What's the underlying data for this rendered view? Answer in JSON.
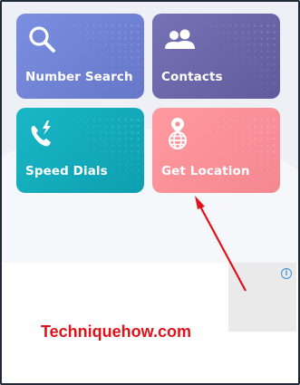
{
  "tiles": [
    {
      "label": "Number Search",
      "icon": "search-icon",
      "color": "#7080d6"
    },
    {
      "label": "Contacts",
      "icon": "contacts-icon",
      "color": "#6b67a9"
    },
    {
      "label": "Speed Dials",
      "icon": "phone-speed-icon",
      "color": "#14abbb"
    },
    {
      "label": "Get Location",
      "icon": "location-globe-icon",
      "color": "#fb9199"
    }
  ],
  "ad": {
    "info_glyph": "i",
    "info_color": "#3b8ed8"
  },
  "annotation": {
    "arrow_color": "#e0121a",
    "target": "Get Location"
  },
  "watermark": {
    "text": "Techniquehow.com",
    "color": "#e0121a"
  }
}
